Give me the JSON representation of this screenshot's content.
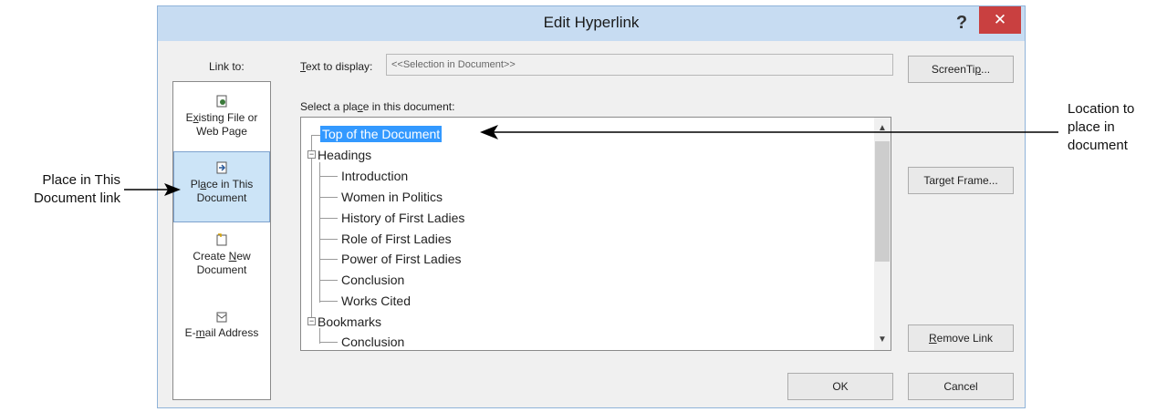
{
  "dialog": {
    "title": "Edit Hyperlink",
    "help_glyph": "?",
    "close_glyph": "✕"
  },
  "link_to": {
    "label": "Link to:",
    "items": [
      {
        "icon": "document-globe-icon",
        "label_pre": "E",
        "label_u": "x",
        "label_post": "isting File or",
        "label_line2": "Web Page"
      },
      {
        "icon": "document-place-icon",
        "label_pre": "Pl",
        "label_u": "a",
        "label_post": "ce in This",
        "label_line2": "Document",
        "selected": true
      },
      {
        "icon": "new-document-icon",
        "label_pre": "Create ",
        "label_u": "N",
        "label_post": "ew",
        "label_line2": "Document"
      },
      {
        "icon": "email-icon",
        "label_pre": "E-",
        "label_u": "m",
        "label_post": "ail Address",
        "label_line2": ""
      }
    ]
  },
  "text_to_display": {
    "label_u": "T",
    "label_rest": "ext to display:",
    "value": "<<Selection in Document>>"
  },
  "select_place": {
    "label_pre": "Select a pla",
    "label_u": "c",
    "label_post": "e in this document:",
    "top": "Top of the Document",
    "headings_label": "Headings",
    "headings": [
      "Introduction",
      "Women in Politics",
      "History of First Ladies",
      "Role of First Ladies",
      "Power of First Ladies",
      "Conclusion",
      "Works Cited"
    ],
    "bookmarks_label": "Bookmarks",
    "bookmarks": [
      "Conclusion"
    ]
  },
  "buttons": {
    "screentip_pre": "ScreenTi",
    "screentip_u": "p",
    "screentip_post": "...",
    "target_frame_pre": "Tar",
    "target_frame_u": "g",
    "target_frame_post": "et Frame...",
    "remove_link_u": "R",
    "remove_link_post": "emove Link",
    "ok": "OK",
    "cancel": "Cancel"
  },
  "callouts": {
    "left_line1": "Place in This",
    "left_line2": "Document link",
    "right_line1": "Location to",
    "right_line2": "place in",
    "right_line3": "document"
  }
}
